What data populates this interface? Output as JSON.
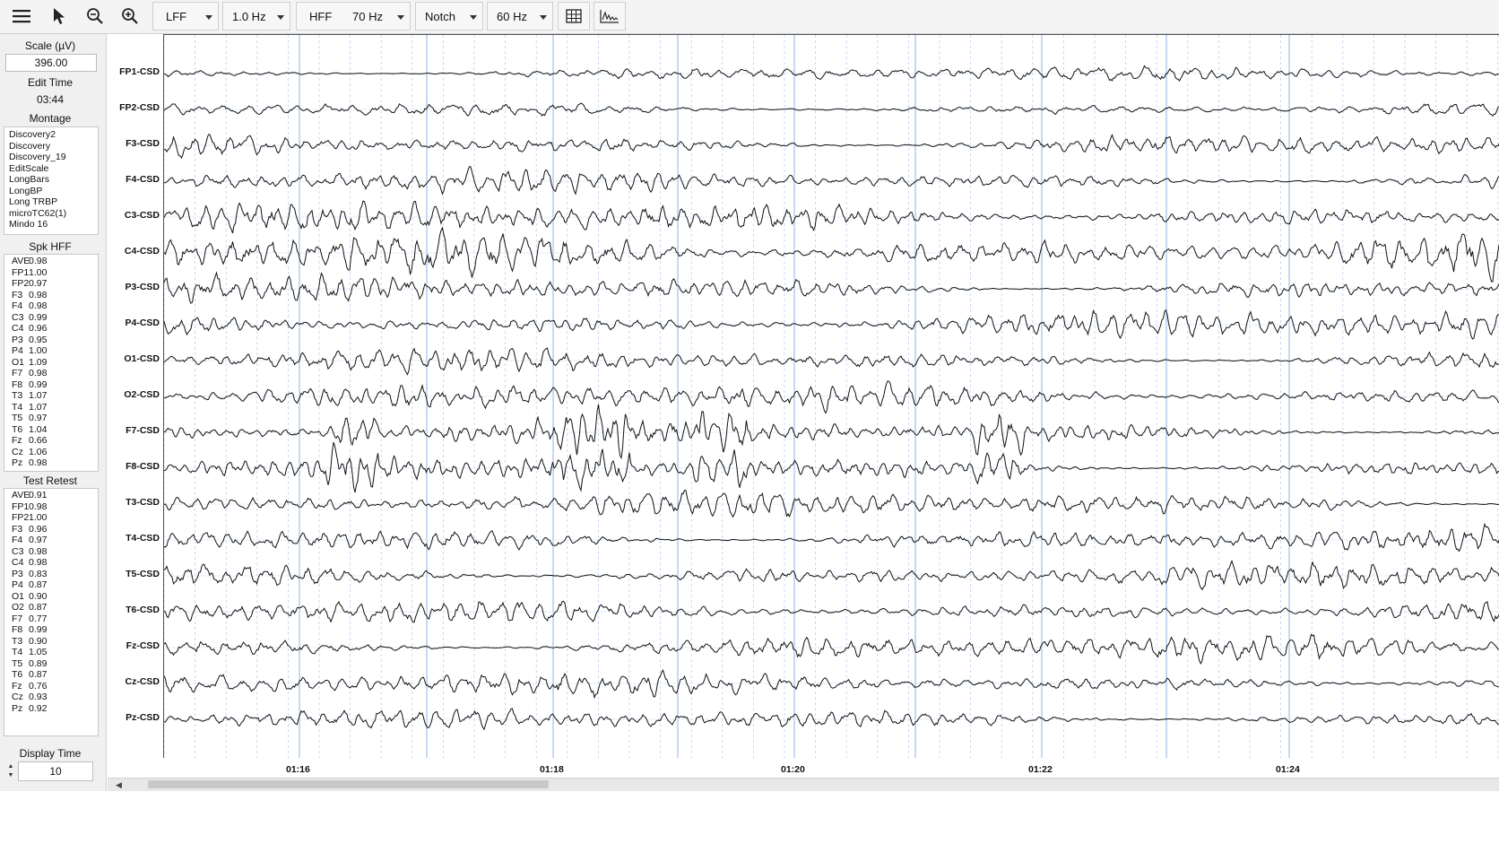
{
  "toolbar": {
    "lff": {
      "label": "LFF",
      "value": "1.0 Hz"
    },
    "hff": {
      "label": "HFF",
      "value": "70 Hz"
    },
    "notch": {
      "label": "Notch",
      "value": "60 Hz"
    }
  },
  "sidebar": {
    "scale_title": "Scale (µV)",
    "scale_value": "396.00",
    "edit_time_title": "Edit Time",
    "edit_time_value": "03:44",
    "montage_title": "Montage",
    "montages": [
      "Discovery2",
      "Discovery",
      "Discovery_19",
      "EditScale",
      "LongBars",
      "LongBP",
      "Long TRBP",
      "microTC62(1)",
      "Mindo 16"
    ],
    "spk_title": "Spk HFF",
    "spk": [
      {
        "ch": "AVE",
        "v": "0.98"
      },
      {
        "ch": "FP1",
        "v": "1.00"
      },
      {
        "ch": "FP2",
        "v": "0.97"
      },
      {
        "ch": "F3",
        "v": "0.98"
      },
      {
        "ch": "F4",
        "v": "0.98"
      },
      {
        "ch": "C3",
        "v": "0.99"
      },
      {
        "ch": "C4",
        "v": "0.96"
      },
      {
        "ch": "P3",
        "v": "0.95"
      },
      {
        "ch": "P4",
        "v": "1.00"
      },
      {
        "ch": "O1",
        "v": "1.09"
      },
      {
        "ch": "F7",
        "v": "0.98"
      },
      {
        "ch": "F8",
        "v": "0.99"
      },
      {
        "ch": "T3",
        "v": "1.07"
      },
      {
        "ch": "T4",
        "v": "1.07"
      },
      {
        "ch": "T5",
        "v": "0.97"
      },
      {
        "ch": "T6",
        "v": "1.04"
      },
      {
        "ch": "Fz",
        "v": "0.66"
      },
      {
        "ch": "Cz",
        "v": "1.06"
      },
      {
        "ch": "Pz",
        "v": "0.98"
      }
    ],
    "retest_title": "Test Retest",
    "retest": [
      {
        "ch": "AVE",
        "v": "0.91"
      },
      {
        "ch": "FP1",
        "v": "0.98"
      },
      {
        "ch": "FP2",
        "v": "1.00"
      },
      {
        "ch": "F3",
        "v": "0.96"
      },
      {
        "ch": "F4",
        "v": "0.97"
      },
      {
        "ch": "C3",
        "v": "0.98"
      },
      {
        "ch": "C4",
        "v": "0.98"
      },
      {
        "ch": "P3",
        "v": "0.83"
      },
      {
        "ch": "P4",
        "v": "0.87"
      },
      {
        "ch": "O1",
        "v": "0.90"
      },
      {
        "ch": "O2",
        "v": "0.87"
      },
      {
        "ch": "F7",
        "v": "0.77"
      },
      {
        "ch": "F8",
        "v": "0.99"
      },
      {
        "ch": "T3",
        "v": "0.90"
      },
      {
        "ch": "T4",
        "v": "1.05"
      },
      {
        "ch": "T5",
        "v": "0.89"
      },
      {
        "ch": "T6",
        "v": "0.87"
      },
      {
        "ch": "Fz",
        "v": "0.76"
      },
      {
        "ch": "Cz",
        "v": "0.93"
      },
      {
        "ch": "Pz",
        "v": "0.92"
      }
    ],
    "display_time_title": "Display Time",
    "display_time_value": "10"
  },
  "channels": [
    "FP1-CSD",
    "FP2-CSD",
    "F3-CSD",
    "F4-CSD",
    "C3-CSD",
    "C4-CSD",
    "P3-CSD",
    "P4-CSD",
    "O1-CSD",
    "O2-CSD",
    "F7-CSD",
    "F8-CSD",
    "T3-CSD",
    "T4-CSD",
    "T5-CSD",
    "T6-CSD",
    "Fz-CSD",
    "Cz-CSD",
    "Pz-CSD"
  ],
  "time_labels": [
    "01:16",
    "01:18",
    "01:20",
    "01:22",
    "01:24"
  ],
  "colors": {
    "trace": "#111111",
    "grid": "#8fb3e6",
    "minor_grid": "#b9cfee"
  }
}
